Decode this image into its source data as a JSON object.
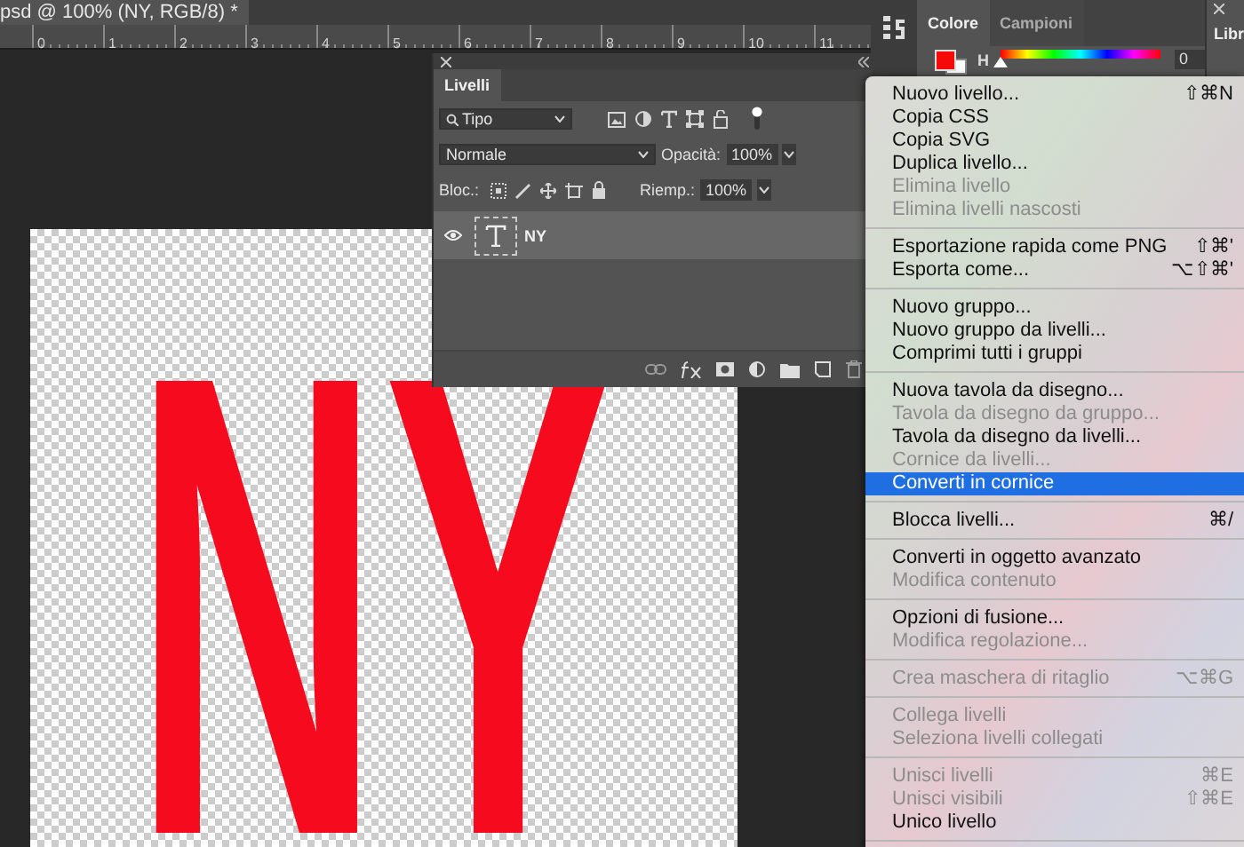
{
  "document": {
    "tab_title": "psd @ 100% (NY, RGB/8) *",
    "ruler_labels": [
      "0",
      "1",
      "2",
      "3",
      "4",
      "5",
      "6",
      "7",
      "8",
      "9",
      "10",
      "11"
    ],
    "canvas_text": "NY"
  },
  "layers_panel": {
    "tab": "Livelli",
    "filter": "Tipo",
    "blend_mode": "Normale",
    "opacity_label": "Opacità:",
    "opacity": "100%",
    "lock_label": "Bloc.:",
    "fill_label": "Riemp.:",
    "fill": "100%",
    "layers": [
      {
        "name": "NY",
        "kind": "text",
        "visible": true,
        "selected": true
      }
    ]
  },
  "color_panel": {
    "tabs": [
      {
        "label": "Colore",
        "selected": true
      },
      {
        "label": "Campioni",
        "selected": false
      }
    ],
    "hue": {
      "label": "H",
      "value": "0",
      "level": 0
    }
  },
  "library_panel": {
    "tab": "Libr"
  },
  "context_menu": {
    "sections": [
      {
        "items": [
          {
            "label": "Nuovo livello...",
            "shortcut": "⇧⌘N",
            "disabled": false,
            "selected": false
          },
          {
            "label": "Copia CSS",
            "disabled": false,
            "selected": false
          },
          {
            "label": "Copia SVG",
            "disabled": false,
            "selected": false
          },
          {
            "label": "Duplica livello...",
            "disabled": false,
            "selected": false
          },
          {
            "label": "Elimina livello",
            "disabled": true,
            "selected": false
          },
          {
            "label": "Elimina livelli nascosti",
            "disabled": true,
            "selected": false
          }
        ]
      },
      {
        "items": [
          {
            "label": "Esportazione rapida come PNG",
            "shortcut": "⇧⌘'",
            "disabled": false,
            "selected": false
          },
          {
            "label": "Esporta come...",
            "shortcut": "⌥⇧⌘'",
            "disabled": false,
            "selected": false
          }
        ]
      },
      {
        "items": [
          {
            "label": "Nuovo gruppo...",
            "disabled": false,
            "selected": false
          },
          {
            "label": "Nuovo gruppo da livelli...",
            "disabled": false,
            "selected": false
          },
          {
            "label": "Comprimi tutti i gruppi",
            "disabled": false,
            "selected": false
          }
        ]
      },
      {
        "items": [
          {
            "label": "Nuova tavola da disegno...",
            "disabled": false,
            "selected": false
          },
          {
            "label": "Tavola da disegno da gruppo...",
            "disabled": true,
            "selected": false
          },
          {
            "label": "Tavola da disegno da livelli...",
            "disabled": false,
            "selected": false
          },
          {
            "label": "Cornice da livelli...",
            "disabled": true,
            "selected": false
          },
          {
            "label": "Converti in cornice",
            "disabled": false,
            "selected": true
          }
        ]
      },
      {
        "items": [
          {
            "label": "Blocca livelli...",
            "shortcut": "⌘/",
            "disabled": false,
            "selected": false
          }
        ]
      },
      {
        "items": [
          {
            "label": "Converti in oggetto avanzato",
            "disabled": false,
            "selected": false
          },
          {
            "label": "Modifica contenuto",
            "disabled": true,
            "selected": false
          }
        ]
      },
      {
        "items": [
          {
            "label": "Opzioni di fusione...",
            "disabled": false,
            "selected": false
          },
          {
            "label": "Modifica regolazione...",
            "disabled": true,
            "selected": false
          }
        ]
      },
      {
        "items": [
          {
            "label": "Crea maschera di ritaglio",
            "shortcut": "⌥⌘G",
            "disabled": true,
            "selected": false
          }
        ]
      },
      {
        "items": [
          {
            "label": "Collega livelli",
            "disabled": true,
            "selected": false
          },
          {
            "label": "Seleziona livelli collegati",
            "disabled": true,
            "selected": false
          }
        ]
      },
      {
        "items": [
          {
            "label": "Unisci livelli",
            "shortcut": "⌘E",
            "disabled": true,
            "selected": false
          },
          {
            "label": "Unisci visibili",
            "shortcut": "⇧⌘E",
            "disabled": true,
            "selected": false
          },
          {
            "label": "Unico livello",
            "disabled": false,
            "selected": false
          }
        ]
      }
    ]
  }
}
